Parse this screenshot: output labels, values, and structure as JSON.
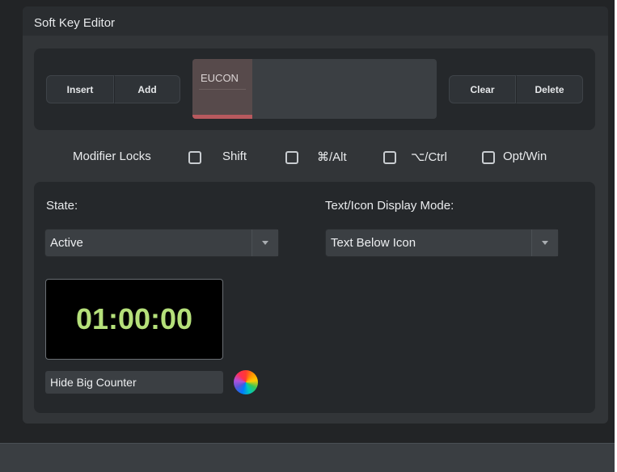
{
  "window": {
    "title": "Soft Key Editor"
  },
  "toolbar": {
    "insert_label": "Insert",
    "add_label": "Add",
    "clear_label": "Clear",
    "delete_label": "Delete"
  },
  "soft_key": {
    "label": "EUCON"
  },
  "modifier_locks": {
    "label": "Modifier Locks",
    "options": [
      {
        "label": "Shift",
        "checked": false
      },
      {
        "label": "⌘/Alt",
        "checked": false
      },
      {
        "label": "⌥/Ctrl",
        "checked": false
      },
      {
        "label": "Opt/Win",
        "checked": false
      }
    ]
  },
  "state": {
    "label": "State:",
    "value": "Active"
  },
  "display_mode": {
    "label": "Text/Icon Display Mode:",
    "value": "Text Below Icon"
  },
  "counter": {
    "value": "01:00:00"
  },
  "hide_counter": {
    "label": "Hide Big Counter"
  },
  "colors": {
    "accent_red": "#b8595e",
    "counter_green": "#b5e07a"
  }
}
